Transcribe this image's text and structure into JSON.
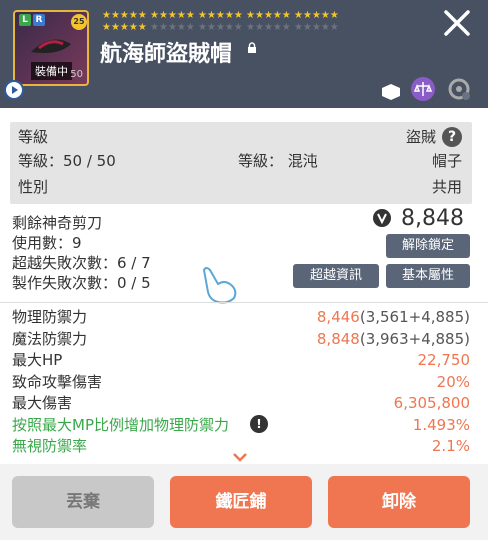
{
  "header": {
    "title": "航海師盜賊帽",
    "equip_badge": "裝備中",
    "level_small": "50",
    "level_badge": "25",
    "lr_left": "L",
    "lr_right": "R",
    "stars_filled": "★★★★★ ★★★★★ ★★★★★ ★★★★★ ★★★★★",
    "stars_row2_filled": "★★★★★",
    "stars_row2_dim": "★★★★★ ★★★★★ ★★★★★ ★★★★★",
    "star_count_filled": 30,
    "star_count_total": 45
  },
  "info": {
    "level_label": "等級",
    "job": "盜賊",
    "level_value": "等級：50 / 50",
    "grade": "等級： 混沌",
    "category": "帽子",
    "gender_label": "性別",
    "gender": "共用"
  },
  "scissors": {
    "label": "剩餘神奇剪刀",
    "uses": "使用數：9",
    "transcend_fail": "超越失敗次數：6 / 7",
    "craft_fail": "製作失敗次數：0 / 5",
    "power": "8,848",
    "unlock_button": "解除鎖定",
    "transcend_button": "超越資訊",
    "base_button": "基本屬性"
  },
  "stats": [
    {
      "label": "物理防禦力",
      "value": "8,446",
      "extra": "(3,561+4,885)",
      "color": "dark"
    },
    {
      "label": "魔法防禦力",
      "value": "8,848",
      "extra": "(3,963+4,885)",
      "color": "dark"
    },
    {
      "label": "最大HP",
      "value": "22,750",
      "extra": "",
      "color": "dark"
    },
    {
      "label": "致命攻擊傷害",
      "value": "20%",
      "extra": "",
      "color": "dark"
    },
    {
      "label": "最大傷害",
      "value": "6,305,800",
      "extra": "",
      "color": "dark"
    },
    {
      "label": "按照最大MP比例增加物理防禦力",
      "value": "1.493%",
      "extra": "",
      "color": "green"
    },
    {
      "label": "無視防禦率",
      "value": "2.1%",
      "extra": "",
      "color": "green"
    }
  ],
  "footer": {
    "discard": "丟棄",
    "smith": "鐵匠鋪",
    "unequip": "卸除"
  },
  "colors": {
    "header_bg": "#475161",
    "accent_orange": "#ef7650",
    "green": "#3aa84a",
    "disabled": "#c8c8c8"
  }
}
